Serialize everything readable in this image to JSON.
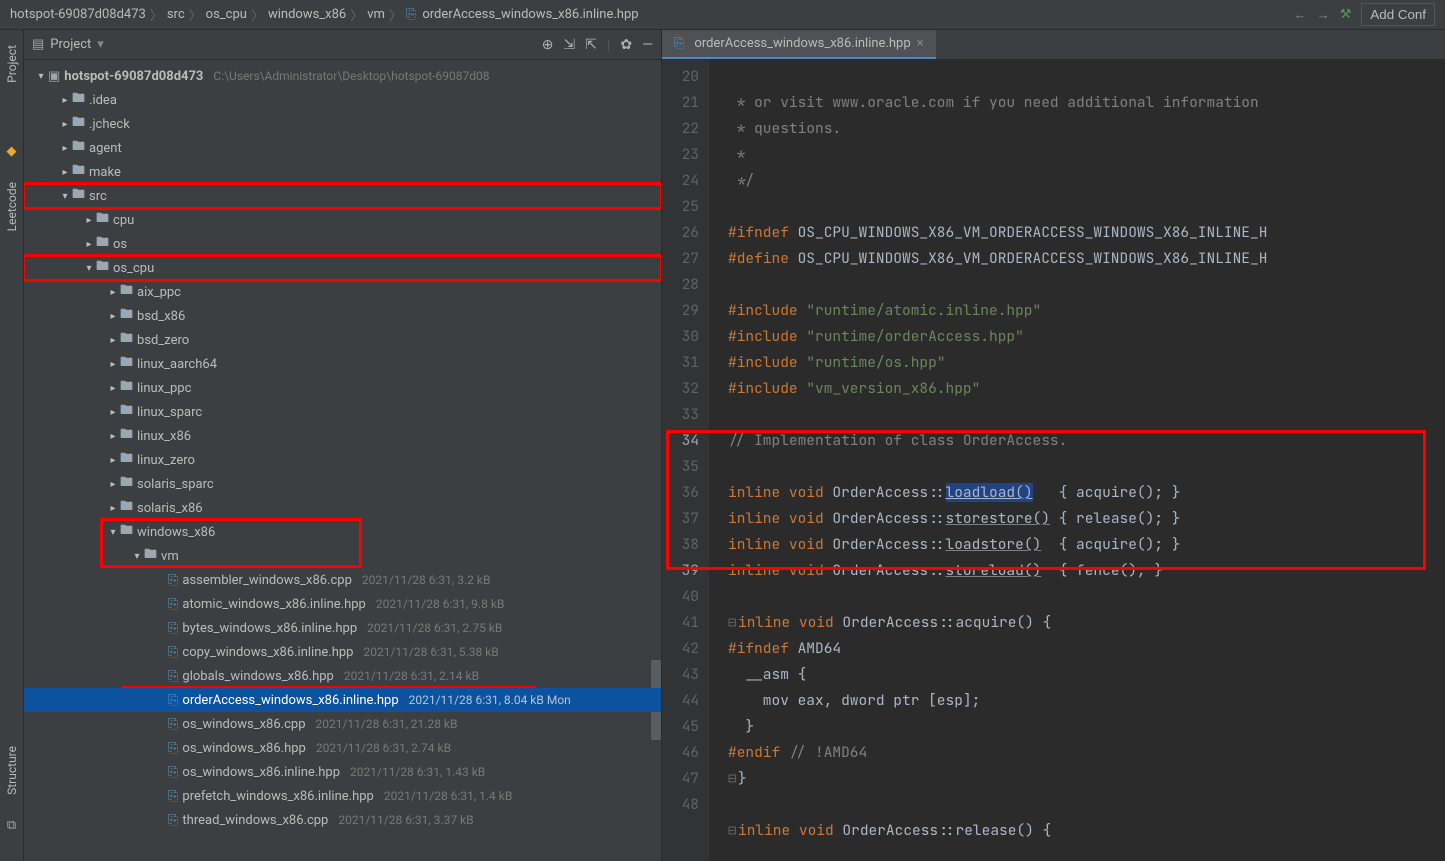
{
  "breadcrumb": {
    "items": [
      "hotspot-69087d08d473",
      "src",
      "os_cpu",
      "windows_x86",
      "vm",
      "orderAccess_windows_x86.inline.hpp"
    ]
  },
  "toolbar": {
    "add_config": "Add Conf"
  },
  "sidebar": {
    "project_label": "Project",
    "leetcode_label": "Leetcode",
    "structure_label": "Structure"
  },
  "project_panel": {
    "title": "Project"
  },
  "tree": {
    "root": {
      "name": "hotspot-69087d08d473",
      "path": "C:\\Users\\Administrator\\Desktop\\hotspot-69087d08"
    },
    "folders": [
      ".idea",
      ".jcheck",
      "agent",
      "make",
      "src",
      "cpu",
      "os",
      "os_cpu",
      "aix_ppc",
      "bsd_x86",
      "bsd_zero",
      "linux_aarch64",
      "linux_ppc",
      "linux_sparc",
      "linux_x86",
      "linux_zero",
      "solaris_sparc",
      "solaris_x86",
      "windows_x86",
      "vm"
    ],
    "files": [
      {
        "name": "assembler_windows_x86.cpp",
        "meta": "2021/11/28 6:31, 3.2 kB"
      },
      {
        "name": "atomic_windows_x86.inline.hpp",
        "meta": "2021/11/28 6:31, 9.8 kB"
      },
      {
        "name": "bytes_windows_x86.inline.hpp",
        "meta": "2021/11/28 6:31, 2.75 kB"
      },
      {
        "name": "copy_windows_x86.inline.hpp",
        "meta": "2021/11/28 6:31, 5.38 kB"
      },
      {
        "name": "globals_windows_x86.hpp",
        "meta": "2021/11/28 6:31, 2.14 kB"
      },
      {
        "name": "orderAccess_windows_x86.inline.hpp",
        "meta": "2021/11/28 6:31, 8.04 kB Mon"
      },
      {
        "name": "os_windows_x86.cpp",
        "meta": "2021/11/28 6:31, 21.28 kB"
      },
      {
        "name": "os_windows_x86.hpp",
        "meta": "2021/11/28 6:31, 2.74 kB"
      },
      {
        "name": "os_windows_x86.inline.hpp",
        "meta": "2021/11/28 6:31, 1.43 kB"
      },
      {
        "name": "prefetch_windows_x86.inline.hpp",
        "meta": "2021/11/28 6:31, 1.4 kB"
      },
      {
        "name": "thread_windows_x86.cpp",
        "meta": "2021/11/28 6:31, 3.37 kB"
      }
    ]
  },
  "tab": {
    "name": "orderAccess_windows_x86.inline.hpp"
  },
  "editor": {
    "line_start": 20,
    "line_end": 48,
    "lines": {
      "20": " * or visit www.oracle.com if you need additional information ",
      "21": " * questions.",
      "22": " *",
      "23": " */",
      "24": "",
      "25_ifndef": "#ifndef",
      "25_macro": "OS_CPU_WINDOWS_X86_VM_ORDERACCESS_WINDOWS_X86_INLINE_H",
      "26_define": "#define",
      "26_macro": "OS_CPU_WINDOWS_X86_VM_ORDERACCESS_WINDOWS_X86_INLINE_H",
      "27": "",
      "28_inc": "#include",
      "28_str": "\"runtime/atomic.inline.hpp\"",
      "29_inc": "#include",
      "29_str": "\"runtime/orderAccess.hpp\"",
      "30_inc": "#include",
      "30_str": "\"runtime/os.hpp\"",
      "31_inc": "#include",
      "31_str": "\"vm_version_x86.hpp\"",
      "32": "",
      "33": "// Implementation of class OrderAccess.",
      "34": "",
      "35_a": "inline",
      "35_b": "void",
      "35_c": "OrderAccess::",
      "35_d": "loadload()",
      "35_e": "   { acquire(); }",
      "36_a": "inline",
      "36_b": "void",
      "36_c": "OrderAccess::",
      "36_d": "storestore()",
      "36_e": " { release(); }",
      "37_a": "inline",
      "37_b": "void",
      "37_c": "OrderAccess::",
      "37_d": "loadstore()",
      "37_e": "  { acquire(); }",
      "38_a": "inline",
      "38_b": "void",
      "38_c": "OrderAccess::",
      "38_d": "storeload()",
      "38_e": "  { fence(); }",
      "39": "",
      "40_a": "inline",
      "40_b": "void",
      "40_c": "OrderAccess::acquire() {",
      "41_a": "#ifndef",
      "41_b": "AMD64",
      "42": "  __asm {",
      "43": "    mov eax, dword ptr [esp];",
      "44": "  }",
      "45_a": "#endif",
      "45_b": " // !AMD64",
      "46": "}",
      "47": "",
      "48_a": "inline",
      "48_b": "void",
      "48_c": "OrderAccess::release() {"
    }
  }
}
